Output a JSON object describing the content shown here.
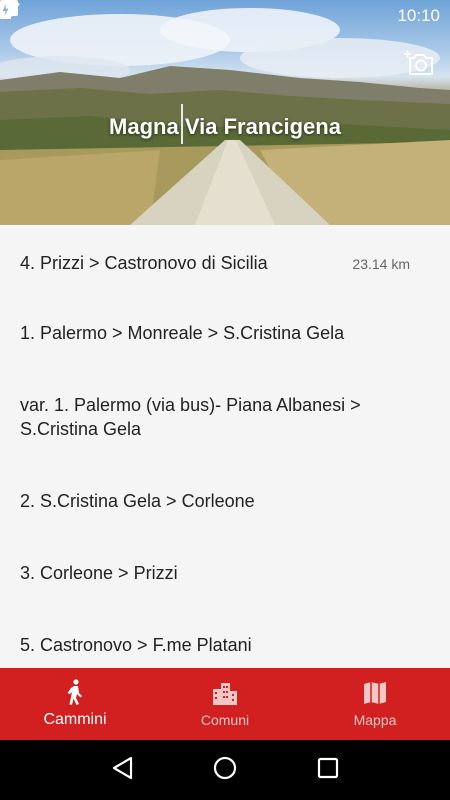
{
  "status_bar": {
    "time": "10:10",
    "left_icons": [
      "news-icon",
      "briefcase-icon",
      "android-icon"
    ],
    "right_icons": [
      "bluetooth-icon",
      "do-not-disturb-icon",
      "wifi-icon",
      "battery-charging-icon"
    ]
  },
  "header": {
    "title": "Magna Via Francigena",
    "camera_icon": "add-photo-icon"
  },
  "routes": [
    {
      "name": "4. Prizzi > Castronovo di Sicilia",
      "distance": "23.14 km"
    },
    {
      "name": "1. Palermo > Monreale > S.Cristina Gela",
      "distance": ""
    },
    {
      "name": "var. 1. Palermo (via bus)- Piana Albanesi > S.Cristina Gela",
      "distance": ""
    },
    {
      "name": "2. S.Cristina Gela > Corleone",
      "distance": ""
    },
    {
      "name": "3. Corleone > Prizzi",
      "distance": ""
    },
    {
      "name": "5. Castronovo > F.me Platani",
      "distance": ""
    }
  ],
  "bottom_nav": {
    "items": [
      {
        "label": "Cammini",
        "icon": "walking-icon",
        "active": true
      },
      {
        "label": "Comuni",
        "icon": "city-icon",
        "active": false
      },
      {
        "label": "Mappa",
        "icon": "map-icon",
        "active": false
      }
    ]
  },
  "system_nav": [
    "back-icon",
    "home-icon",
    "recents-icon"
  ],
  "colors": {
    "accent": "#d21f1f",
    "list_background": "#f5f5f5",
    "text": "#222222"
  }
}
